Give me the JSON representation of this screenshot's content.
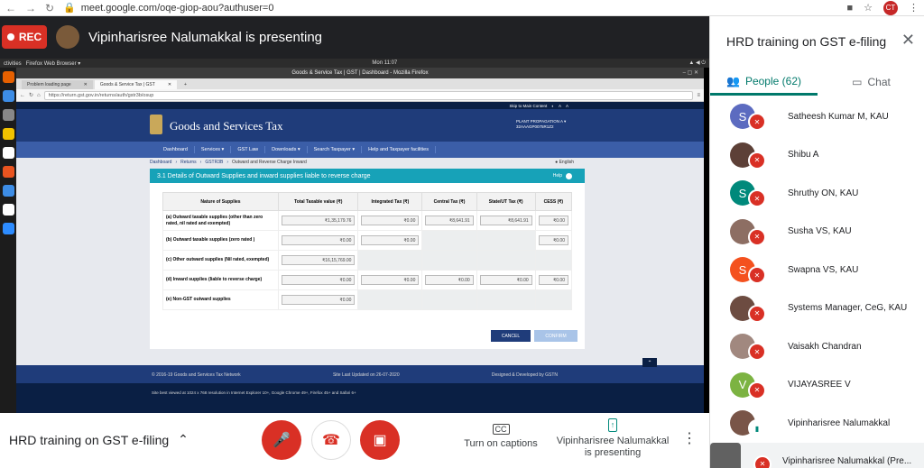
{
  "browser": {
    "url": "meet.google.com/oqe-giop-aou?authuser=0",
    "profile_initials": "CT"
  },
  "meet": {
    "rec_label": "REC",
    "presenter_text": "Vipinharisree Nalumakkal is presenting",
    "meeting_title": "HRD training on GST e-filing",
    "captions_label": "Turn on captions",
    "presenting_line1": "Vipinharisree Nalumakkal",
    "presenting_line2": "is presenting"
  },
  "shared": {
    "activities": "ctivities",
    "ff_label": "Firefox Web Browser ▾",
    "clock": "Mon 11:07",
    "window_title": "Goods & Service Tax | GST | Dashboard - Mozilla Firefox",
    "tab1": "Problem loading page",
    "tab2": "Goods & Service Tax | GST",
    "url": "https://return.gst.gov.in/returns/auth/gstr3b/osup",
    "gst": {
      "skip": "Skip to Main Content",
      "a1": "A",
      "a2": "A",
      "title": "Goods and Services Tax",
      "user_line1": "PLANT PROPAGATION A ▾",
      "user_line2": "32AAAGP0075R1Z2",
      "nav": [
        "Dashboard",
        "Services ▾",
        "GST Law",
        "Downloads ▾",
        "Search Taxpayer ▾",
        "Help and Taxpayer facilities"
      ],
      "crumbs": [
        "Dashboard",
        "Returns",
        "GSTR3B",
        "Outward and Reverse Charge Inward"
      ],
      "lang": "English",
      "section_title": "3.1 Details of Outward Supplies and inward supplies liable to reverse charge",
      "help": "Help",
      "headers": [
        "Nature of Supplies",
        "Total Taxable value (₹)",
        "Integrated Tax (₹)",
        "Central Tax (₹)",
        "State/UT Tax (₹)",
        "CESS (₹)"
      ],
      "rows": [
        {
          "label": "(a) Outward taxable supplies (other than zero rated, nil rated and exempted)",
          "v": [
            "₹1,35,179.76",
            "₹0.00",
            "₹8,641.91",
            "₹8,641.91",
            "₹0.00"
          ]
        },
        {
          "label": "(b) Outward taxable supplies (zero rated )",
          "v": [
            "₹0.00",
            "₹0.00",
            "",
            "",
            "₹0.00"
          ]
        },
        {
          "label": "(c) Other outward supplies (Nil rated, exempted)",
          "v": [
            "₹16,15,769.00",
            "",
            "",
            "",
            ""
          ]
        },
        {
          "label": "(d) Inward supplies (liable to reverse charge)",
          "v": [
            "₹0.00",
            "₹0.00",
            "₹0.00",
            "₹0.00",
            "₹0.00"
          ]
        },
        {
          "label": "(e) Non-GST outward supplies",
          "v": [
            "₹0.00",
            "",
            "",
            "",
            ""
          ]
        }
      ],
      "cancel": "CANCEL",
      "confirm": "CONFIRM",
      "foot_left": "© 2016-19 Goods and Services Tax Network",
      "foot_mid": "Site Last Updated on 26-07-2020",
      "foot_right": "Designed & Developed by GSTN",
      "foot_note": "Site best viewed at 1024 x 768 resolution in Internet Explorer 10+, Google Chrome 49+, Firefox 45+ and Safari 6+"
    }
  },
  "panel": {
    "title": "HRD training on GST e-filing",
    "people_tab": "People (62)",
    "chat_tab": "Chat",
    "participants": [
      {
        "name": "Satheesh Kumar M, KAU",
        "initial": "S",
        "color": "#5c6bc0"
      },
      {
        "name": "Shibu A",
        "initial": "",
        "color": "#5d4037"
      },
      {
        "name": "Shruthy ON, KAU",
        "initial": "S",
        "color": "#00897b"
      },
      {
        "name": "Susha VS, KAU",
        "initial": "",
        "color": "#8d6e63"
      },
      {
        "name": "Swapna VS, KAU",
        "initial": "S",
        "color": "#f4511e"
      },
      {
        "name": "Systems Manager, CeG, KAU",
        "initial": "",
        "color": "#6d4c41"
      },
      {
        "name": "Vaisakh Chandran",
        "initial": "",
        "color": "#a1887f"
      },
      {
        "name": "VIJAYASREE V",
        "initial": "V",
        "color": "#7cb342"
      },
      {
        "name": "Vipinharisree Nalumakkal",
        "initial": "",
        "color": "#795548"
      },
      {
        "name": "Vipinharisree Nalumakkal (Pre...",
        "initial": "",
        "color": "#616161"
      }
    ]
  }
}
